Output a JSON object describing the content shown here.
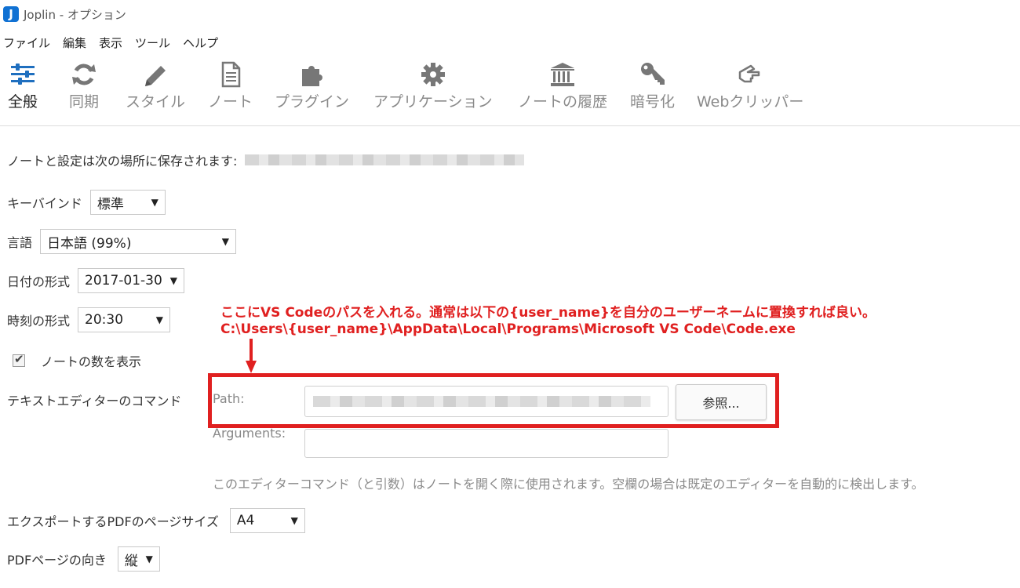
{
  "window": {
    "logo_letter": "J",
    "title": "Joplin - オプション"
  },
  "menu": [
    "ファイル",
    "編集",
    "表示",
    "ツール",
    "ヘルプ"
  ],
  "toolbar": [
    {
      "label": "全般",
      "icon": "sliders-icon",
      "active": true
    },
    {
      "label": "同期",
      "icon": "sync-icon"
    },
    {
      "label": "スタイル",
      "icon": "pencil-icon"
    },
    {
      "label": "ノート",
      "icon": "note-icon"
    },
    {
      "label": "プラグイン",
      "icon": "puzzle-icon"
    },
    {
      "label": "アプリケーション",
      "icon": "gear-icon"
    },
    {
      "label": "ノートの履歴",
      "icon": "history-icon"
    },
    {
      "label": "暗号化",
      "icon": "key-icon"
    },
    {
      "label": "Webクリッパー",
      "icon": "hand-icon"
    }
  ],
  "settings": {
    "storage_label": "ノートと設定は次の場所に保存されます:",
    "keymap_label": "キーバインド",
    "keymap_value": "標準",
    "language_label": "言語",
    "language_value": "日本語 (99%)",
    "date_label": "日付の形式",
    "date_value": "2017-01-30",
    "time_label": "時刻の形式",
    "time_value": "20:30",
    "note_count_label": "ノートの数を表示",
    "note_count_checked": true,
    "editor_label": "テキストエディターのコマンド",
    "path_label": "Path:",
    "browse_label": "参照...",
    "args_label": "Arguments:",
    "editor_help": "このエディターコマンド（と引数）はノートを開く際に使用されます。空欄の場合は既定のエディターを自動的に検出します。",
    "pdf_size_label": "エクスポートするPDFのページサイズ",
    "pdf_size_value": "A4",
    "pdf_orient_label": "PDFページの向き",
    "pdf_orient_value": "縦"
  },
  "annotation": {
    "line1": "ここにVS Codeのパスを入れる。通常は以下の{user_name}を自分のユーザーネームに置換すれば良い。",
    "line2": "C:\\Users\\{user_name}\\AppData\\Local\\Programs\\Microsoft VS Code\\Code.exe",
    "color": "#e02020"
  },
  "caret_glyph": "▼",
  "check_glyph": "✔"
}
